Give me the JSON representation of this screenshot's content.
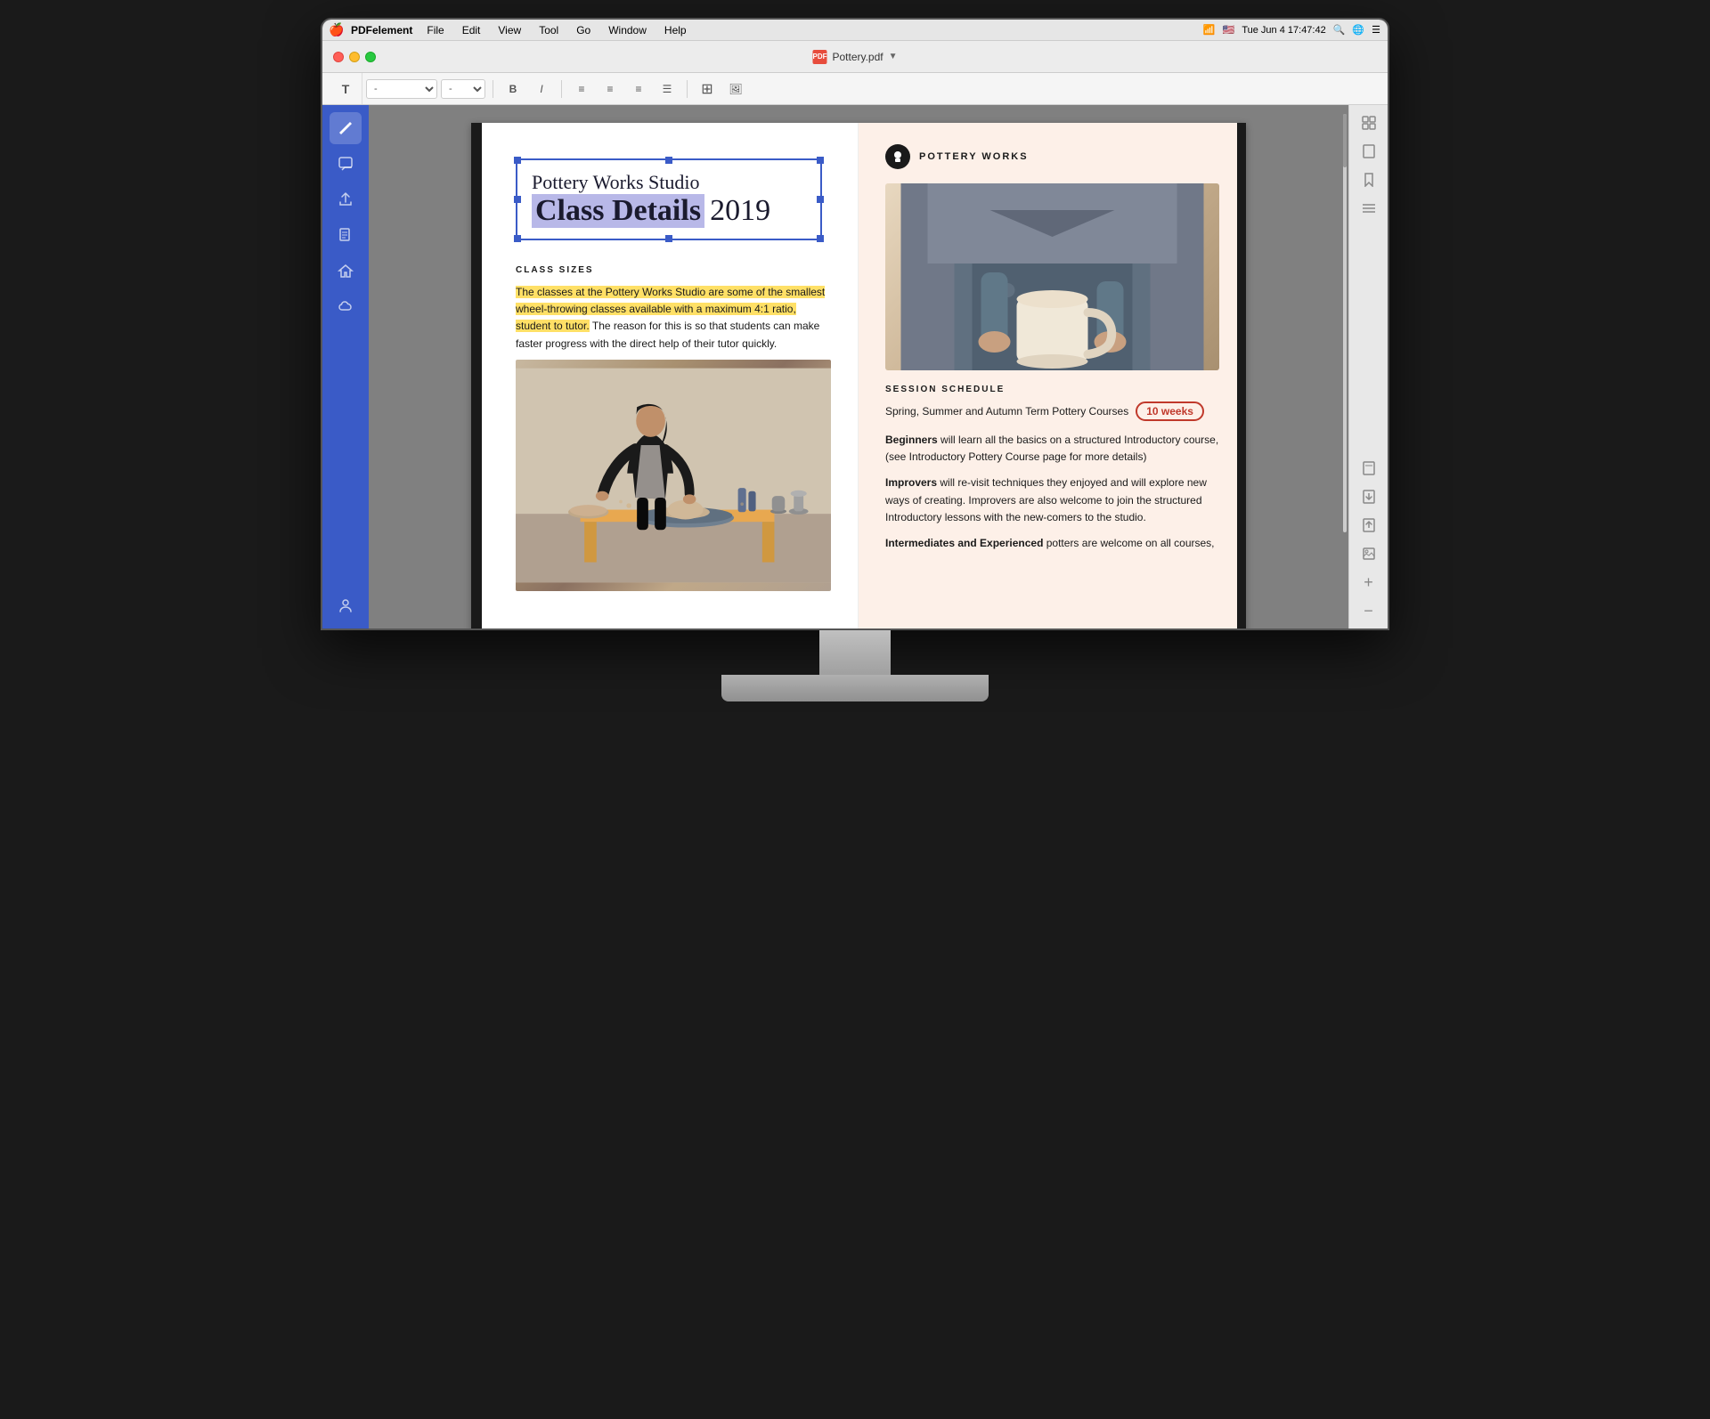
{
  "menubar": {
    "apple": "🍎",
    "appname": "PDFelement",
    "items": [
      "File",
      "Edit",
      "View",
      "Tool",
      "Go",
      "Window",
      "Help"
    ],
    "datetime": "Tue Jun 4  17:47:42",
    "filename": "Pottery.pdf"
  },
  "toolbar": {
    "text_tool": "T",
    "font_placeholder": "-",
    "size_placeholder": "-",
    "bold": "B",
    "italic": "I",
    "align_left": "≡",
    "align_center": "≡",
    "align_right": "≡"
  },
  "sidebar_left": {
    "icons": [
      "✏️",
      "✉",
      "➤",
      "☰",
      "⌂",
      "☁"
    ]
  },
  "pdf": {
    "title_line1": "Pottery Works Studio",
    "title_line2_pre": "Class Details",
    "title_year": "2019",
    "class_sizes_heading": "CLASS SIZES",
    "highlighted_paragraph": "The classes at the Pottery Works Studio are some of the smallest wheel-throwing classes available with a maximum 4:1 ratio, student to tutor.",
    "normal_paragraph": "The reason for this is so that students can make faster progress with the direct help of their tutor quickly.",
    "right_logo_text": "POTTERY WORKS",
    "session_schedule_heading": "SESSION SCHEDULE",
    "session_subtitle_text": "Spring, Summer and Autumn Term Pottery Courses",
    "circled_badge": "10 weeks",
    "beginners_label": "Beginners",
    "beginners_text": "will learn all the basics on a structured Introductory course, (see Introductory Pottery Course page for more details)",
    "improvers_label": "Improvers",
    "improvers_text": "will re-visit techniques they enjoyed and will explore new ways of creating. Improvers are also welcome to join the structured Introductory lessons with the new-comers to the studio.",
    "intermediates_label": "Intermediates and Experienced",
    "intermediates_text": "potters are welcome on all courses,"
  },
  "right_sidebar": {
    "icons": [
      "⊞",
      "📄",
      "🔖",
      "☰",
      "📄",
      "📄",
      "📄",
      "🔲",
      "📄",
      "+",
      "—"
    ]
  }
}
